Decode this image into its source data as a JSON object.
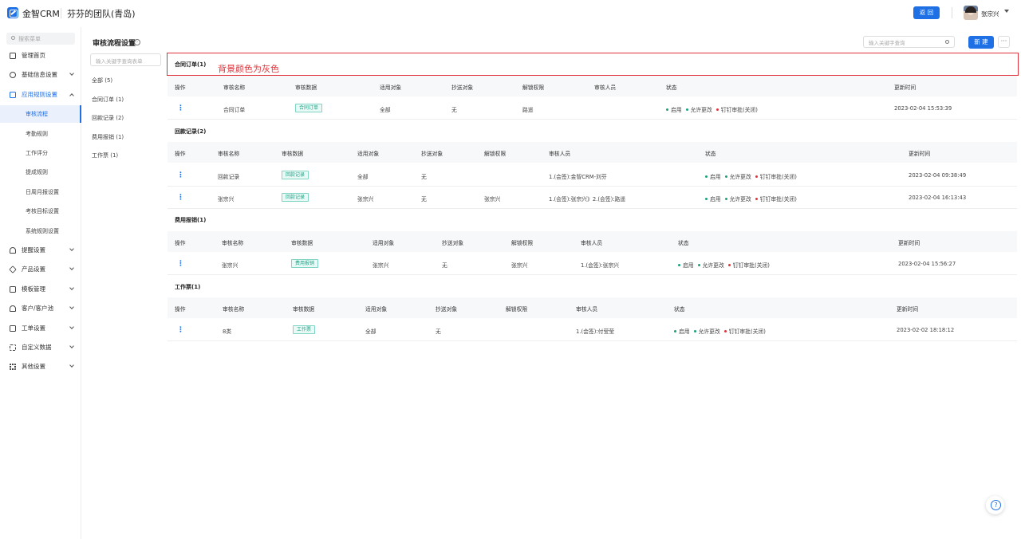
{
  "header": {
    "app_name": "金智CRM",
    "team_name": "芬芬的团队(青岛)",
    "back_label": "返 回",
    "user_name": "张宗兴"
  },
  "sidebar": {
    "search_placeholder": "搜索菜单",
    "items": [
      {
        "label": "管理首页"
      },
      {
        "label": "基础信息设置"
      },
      {
        "label": "应用规则设置"
      },
      {
        "label": "提醒设置"
      },
      {
        "label": "产品设置"
      },
      {
        "label": "模板管理"
      },
      {
        "label": "客户/客户池"
      },
      {
        "label": "工单设置"
      },
      {
        "label": "自定义数据"
      },
      {
        "label": "其他设置"
      }
    ],
    "sub_items": [
      {
        "label": "审核流程"
      },
      {
        "label": "考勤规则"
      },
      {
        "label": "工作评分"
      },
      {
        "label": "提成规则"
      },
      {
        "label": "日周月报设置"
      },
      {
        "label": "考核目标设置"
      },
      {
        "label": "系统规则设置"
      }
    ]
  },
  "page": {
    "title": "审核流程设置",
    "search_placeholder": "输入关键字查询",
    "new_label": "新 建",
    "more_label": "···",
    "category_search_placeholder": "输入关键字查询表单",
    "categories": [
      {
        "label": "全部",
        "count": "(5)"
      },
      {
        "label": "合同订单",
        "count": "(1)"
      },
      {
        "label": "回款记录",
        "count": "(2)"
      },
      {
        "label": "费用报销",
        "count": "(1)"
      },
      {
        "label": "工作票",
        "count": "(1)"
      }
    ]
  },
  "annotation": {
    "text": "背景颜色为灰色"
  },
  "columns": [
    "操作",
    "审核名称",
    "审核数据",
    "适用对象",
    "抄送对象",
    "解锁权限",
    "审核人员",
    "状态",
    "更新时间"
  ],
  "status_labels": {
    "enabled": "启用",
    "allow_edit": "允许更改",
    "dingding": "钉钉审批(关闭)"
  },
  "sections": [
    {
      "title": "合同订单(1)",
      "rows": [
        {
          "name": "合同订单",
          "tag": "合同订单",
          "target": "全部",
          "cc": "无",
          "unlock": "路遥",
          "reviewers": "",
          "updated": "2023-02-04 15:53:39"
        }
      ]
    },
    {
      "title": "回款记录(2)",
      "rows": [
        {
          "name": "回款记录",
          "tag": "回款记录",
          "target": "全部",
          "cc": "无",
          "unlock": "",
          "reviewers": "1.(会签):金智CRM-刘芬",
          "updated": "2023-02-04 09:38:49"
        },
        {
          "name": "张宗兴",
          "tag": "回款记录",
          "target": "张宗兴",
          "cc": "无",
          "unlock": "张宗兴",
          "reviewers": "1.(会签):张宗兴》2.(会签):路遥",
          "updated": "2023-02-04 16:13:43"
        }
      ]
    },
    {
      "title": "费用报销(1)",
      "rows": [
        {
          "name": "张宗兴",
          "tag": "费用报销",
          "target": "张宗兴",
          "cc": "无",
          "unlock": "张宗兴",
          "reviewers": "1.(会签):张宗兴",
          "updated": "2023-02-04 15:56:27"
        }
      ]
    },
    {
      "title": "工作票(1)",
      "rows": [
        {
          "name": "8类",
          "tag": "工作票",
          "target": "全部",
          "cc": "无",
          "unlock": "",
          "reviewers": "1.(会签):付莹莹",
          "updated": "2023-02-02 18:18:12"
        }
      ]
    }
  ]
}
